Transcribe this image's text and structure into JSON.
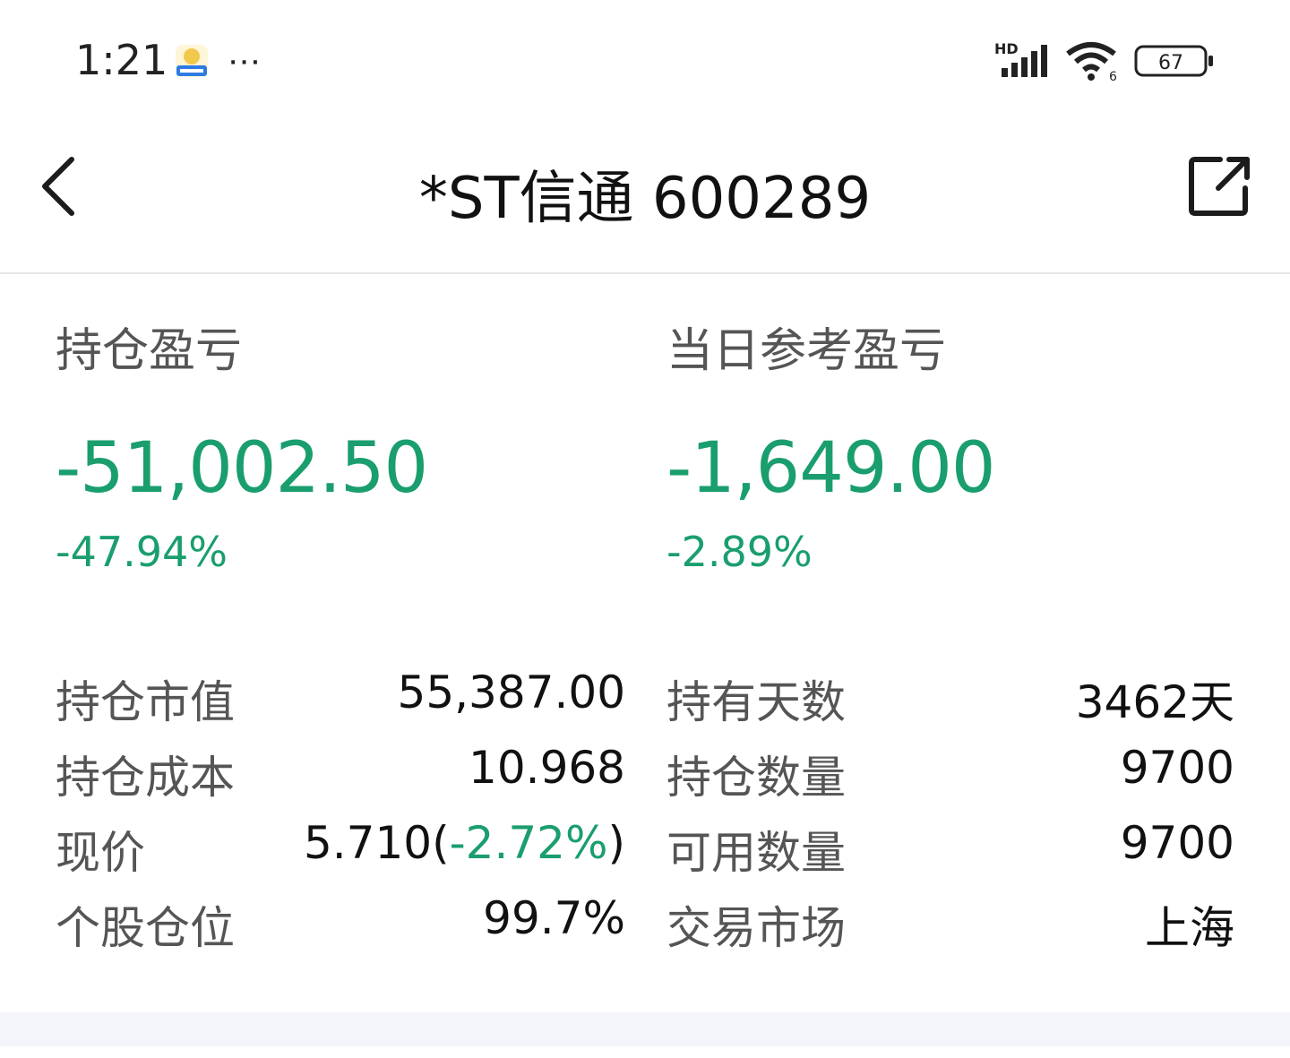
{
  "status_bar": {
    "time": "1:21",
    "app_badge_icon": "dongbei-securities-app-icon",
    "more": "···",
    "signal_label": "HD",
    "battery": "67"
  },
  "nav": {
    "title": "*ST信通 600289",
    "back_icon": "chevron-left-icon",
    "share_icon": "share-external-icon"
  },
  "pl": {
    "position_label": "持仓盈亏",
    "position_value": "-51,002.50",
    "position_pct": "-47.94%",
    "daily_label": "当日参考盈亏",
    "daily_value": "-1,649.00",
    "daily_pct": "-2.89%"
  },
  "details": {
    "market_value_label": "持仓市值",
    "market_value": "55,387.00",
    "holding_days_label": "持有天数",
    "holding_days": "3462天",
    "cost_label": "持仓成本",
    "cost": "10.968",
    "quantity_label": "持仓数量",
    "quantity": "9700",
    "price_label": "现价",
    "price": "5.710",
    "price_change_open": "(",
    "price_change": "-2.72%",
    "price_change_close": ")",
    "available_label": "可用数量",
    "available": "9700",
    "weight_label": "个股仓位",
    "weight": "99.7%",
    "market_label": "交易市场",
    "market": "上海"
  },
  "colors": {
    "loss_green": "#1a9e6e",
    "label_gray": "#555555",
    "bottom_band": "#f4f5fb"
  }
}
